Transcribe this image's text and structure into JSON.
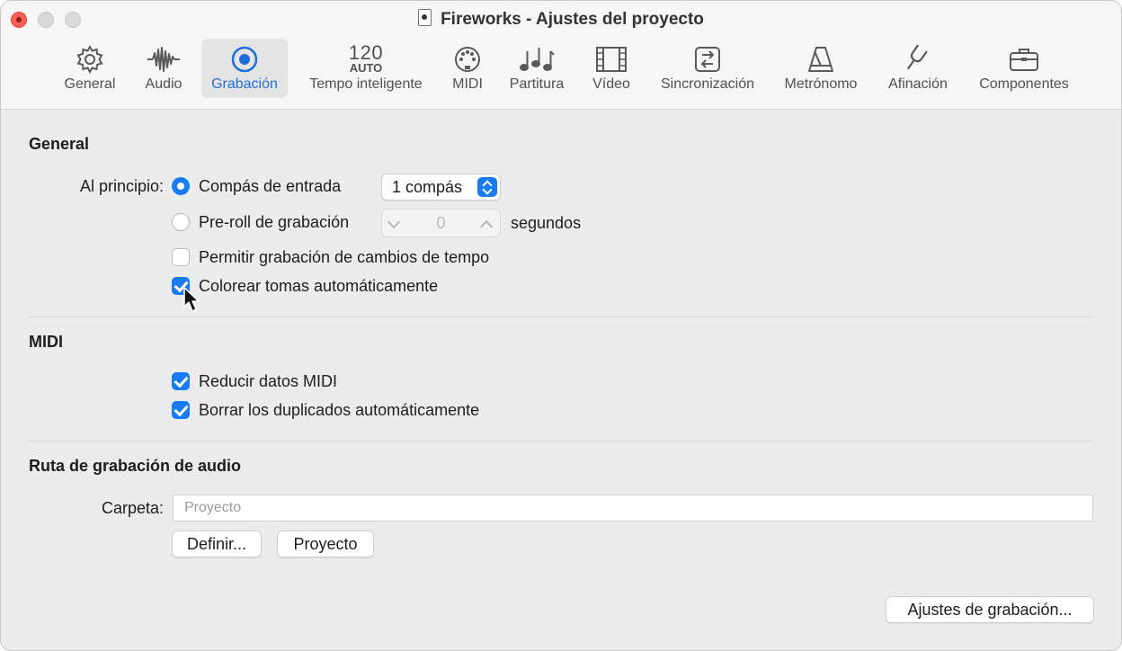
{
  "window": {
    "title": "Fireworks - Ajustes del proyecto"
  },
  "toolbar": {
    "items": [
      {
        "label": "General",
        "icon": "gear-icon"
      },
      {
        "label": "Audio",
        "icon": "waveform-icon"
      },
      {
        "label": "Grabación",
        "icon": "record-icon",
        "active": true
      },
      {
        "label": "Tempo inteligente",
        "icon": "tempo-icon",
        "number": "120",
        "sub": "AUTO"
      },
      {
        "label": "MIDI",
        "icon": "midi-port-icon"
      },
      {
        "label": "Partitura",
        "icon": "music-notes-icon"
      },
      {
        "label": "Vídeo",
        "icon": "film-icon"
      },
      {
        "label": "Sincronización",
        "icon": "sync-icon"
      },
      {
        "label": "Metrónomo",
        "icon": "metronome-icon"
      },
      {
        "label": "Afinación",
        "icon": "tuning-fork-icon"
      },
      {
        "label": "Componentes",
        "icon": "briefcase-icon"
      }
    ]
  },
  "general": {
    "heading": "General",
    "start_label": "Al principio:",
    "count_in_label": "Compás de entrada",
    "count_in_value": "1 compás",
    "preroll_label": "Pre-roll de grabación",
    "preroll_value": "0",
    "preroll_unit": "segundos",
    "allow_tempo_label": "Permitir grabación de cambios de tempo",
    "allow_tempo_checked": false,
    "color_takes_label": "Colorear tomas automáticamente",
    "color_takes_checked": true
  },
  "midi": {
    "heading": "MIDI",
    "reduce_label": "Reducir datos MIDI",
    "reduce_checked": true,
    "dedupe_label": "Borrar los duplicados automáticamente",
    "dedupe_checked": true
  },
  "audio_path": {
    "heading": "Ruta de grabación de audio",
    "folder_label": "Carpeta:",
    "folder_placeholder": "Proyecto",
    "define_button": "Definir...",
    "project_button": "Proyecto"
  },
  "footer": {
    "recording_settings_button": "Ajustes de grabación..."
  },
  "colors": {
    "accent": "#1a7cf5",
    "active_label": "#1e6fd9"
  }
}
